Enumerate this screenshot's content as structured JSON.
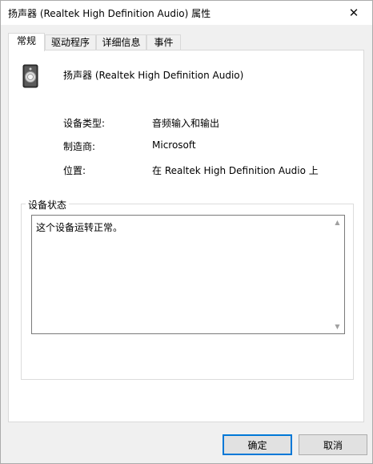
{
  "window": {
    "title": "扬声器 (Realtek High Definition Audio) 属性",
    "close_glyph": "✕"
  },
  "tabs": [
    {
      "label": "常规",
      "active": true
    },
    {
      "label": "驱动程序",
      "active": false
    },
    {
      "label": "详细信息",
      "active": false
    },
    {
      "label": "事件",
      "active": false
    }
  ],
  "device": {
    "name": "扬声器 (Realtek High Definition Audio)",
    "icon": "speaker-icon"
  },
  "properties": [
    {
      "label": "设备类型:",
      "value": "音频输入和输出"
    },
    {
      "label": "制造商:",
      "value": "Microsoft"
    },
    {
      "label": "位置:",
      "value": "在 Realtek High Definition Audio 上"
    }
  ],
  "status": {
    "group_title": "设备状态",
    "text": "这个设备运转正常。"
  },
  "buttons": {
    "ok": "确定",
    "cancel": "取消"
  },
  "colors": {
    "accent": "#0078d7",
    "window_bg": "#f0f0f0",
    "panel_bg": "#ffffff"
  }
}
